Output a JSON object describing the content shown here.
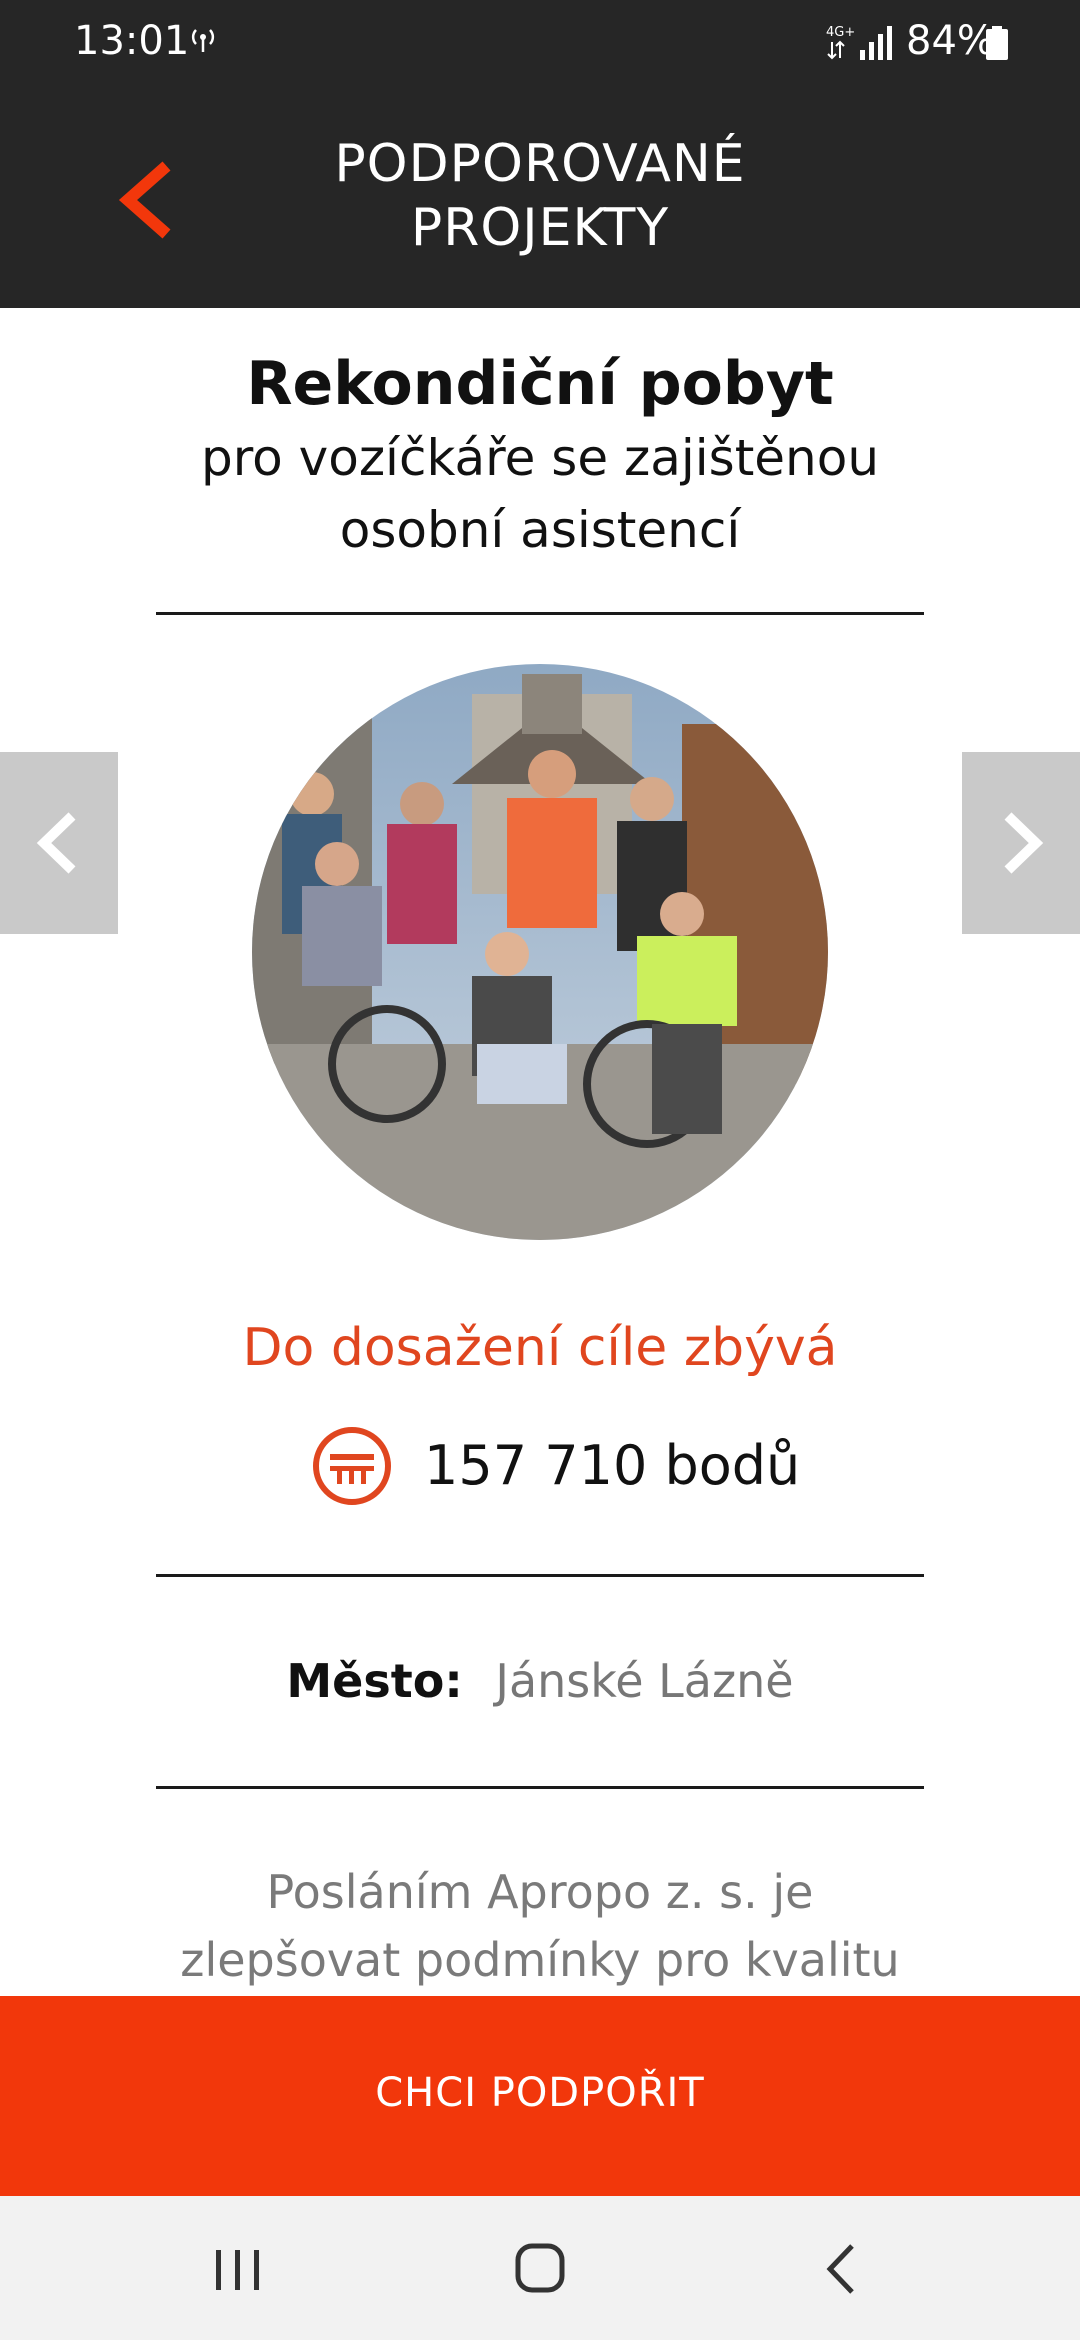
{
  "status_bar": {
    "time": "13:01",
    "network": "4G+",
    "battery": "84%"
  },
  "header": {
    "title": "PODPOROVANÉ PROJEKTY"
  },
  "project": {
    "title": "Rekondiční pobyt",
    "subtitle": "pro vozíčkáře se zajištěnou osobní asistencí",
    "goal_label": "Do dosažení cíle zbývá",
    "points": "157 710 bodů",
    "city_label": "Město:",
    "city_value": "Jánské Lázně",
    "description": "Posláním Apropo z. s. je zlepšovat podmínky pro kvalitu života lidí s"
  },
  "cta": {
    "label": "CHCI PODPOŘIT"
  },
  "colors": {
    "accent": "#f2370b",
    "goal_text": "#e0461f",
    "header_bg": "#262626"
  },
  "icons": [
    "back-arrow-icon",
    "hotspot-icon",
    "signal-icon",
    "battery-icon",
    "points-coin-icon",
    "chevron-left-icon",
    "chevron-right-icon"
  ]
}
